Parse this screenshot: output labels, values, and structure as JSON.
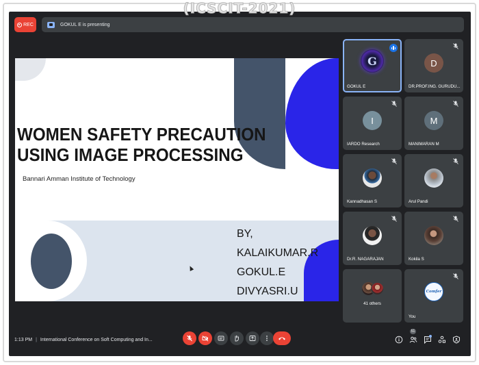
{
  "watermark": "(ICSCIT-2021)",
  "topbar": {
    "rec_label": "REC",
    "presenting_text": "GOKUL E is presenting"
  },
  "slide": {
    "title_line1": "WOMEN SAFETY PRECAUTION",
    "title_line2": "USING IMAGE PROCESSING",
    "subtitle": "Bannari Amman Institute of Technology",
    "by_label": "BY,",
    "authors": [
      "KALAIKUMAR.R",
      "GOKUL.E",
      "DIVYASRI.U"
    ],
    "colors": {
      "blue": "#2a25e8",
      "slate": "#44546a",
      "band": "#dce4ee"
    }
  },
  "participants": [
    {
      "name": "GOKUL E",
      "avatar": "logo-g",
      "status": "speaking"
    },
    {
      "name": "DR.PROF.ING. GURUDU...",
      "avatar": "D",
      "avatar_color": "#795548",
      "status": "muted"
    },
    {
      "name": "IARDO Research",
      "avatar": "I",
      "avatar_color": "#78909c",
      "status": "muted"
    },
    {
      "name": "MANIMARAN M",
      "avatar": "M",
      "avatar_color": "#5f6f7a",
      "status": "muted"
    },
    {
      "name": "Kannadhasan S",
      "avatar": "photo",
      "status": "muted"
    },
    {
      "name": "Arul Pandi",
      "avatar": "photo",
      "status": "muted"
    },
    {
      "name": "Dr.R. NAGARAJAN",
      "avatar": "photo",
      "status": "muted"
    },
    {
      "name": "Kokila S",
      "avatar": "photo",
      "status": "muted"
    },
    {
      "name": "41 others",
      "avatar": "group"
    },
    {
      "name": "You",
      "avatar": "conference-logo",
      "avatar_text": "Comfer",
      "status": "muted"
    }
  ],
  "bottombar": {
    "time": "1:13 PM",
    "meeting_title": "International Conference on Soft Computing and In...",
    "people_count": "51",
    "controls": [
      "mic-off-icon",
      "camera-off-icon",
      "captions-icon",
      "raise-hand-icon",
      "present-icon",
      "more-icon",
      "leave-call-icon"
    ],
    "right_icons": [
      "info-icon",
      "people-icon",
      "chat-icon",
      "activities-icon",
      "host-controls-icon"
    ]
  },
  "accent_colors": {
    "red": "#ea4335",
    "blue": "#1a73e8",
    "surface": "#3c4043",
    "background": "#202124"
  }
}
